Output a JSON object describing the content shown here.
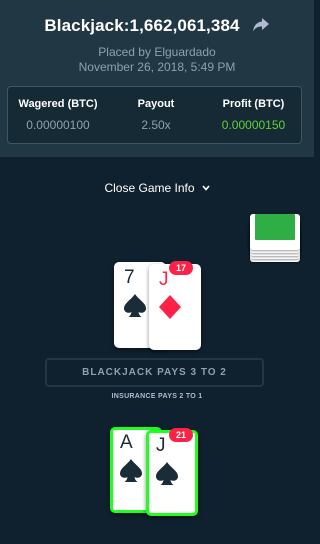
{
  "header": {
    "title": "Blackjack:1,662,061,384",
    "placed_by": "Placed by Elguardado",
    "date": "November 26, 2018, 5:49 PM",
    "stats": {
      "wagered_label": "Wagered (BTC)",
      "wagered_value": "0.00000100",
      "payout_label": "Payout",
      "payout_value": "2.50x",
      "profit_label": "Profit (BTC)",
      "profit_value": "0.00000150"
    }
  },
  "close_info_label": "Close Game Info",
  "dealer": {
    "score": "17",
    "cards": [
      {
        "rank": "7",
        "suit": "spade",
        "color": "#1a2c38"
      },
      {
        "rank": "J",
        "suit": "diamond",
        "color": "#fe2247"
      }
    ]
  },
  "banner": {
    "pays_text": "BLACKJACK PAYS 3 TO 2",
    "insurance_text": "INSURANCE PAYS 2 TO 1"
  },
  "player": {
    "score": "21",
    "cards": [
      {
        "rank": "A",
        "suit": "spade",
        "color": "#1a2c38"
      },
      {
        "rank": "J",
        "suit": "spade",
        "color": "#1a2c38"
      }
    ]
  },
  "colors": {
    "background": "#0f212e",
    "panel": "#213743",
    "profit_green": "#5ed13a",
    "badge_red": "#fe2247",
    "win_border": "#1fff20"
  },
  "icons": [
    "share-arrow-icon",
    "chevron-down-icon",
    "spade-icon",
    "diamond-icon",
    "card-deck-icon"
  ]
}
